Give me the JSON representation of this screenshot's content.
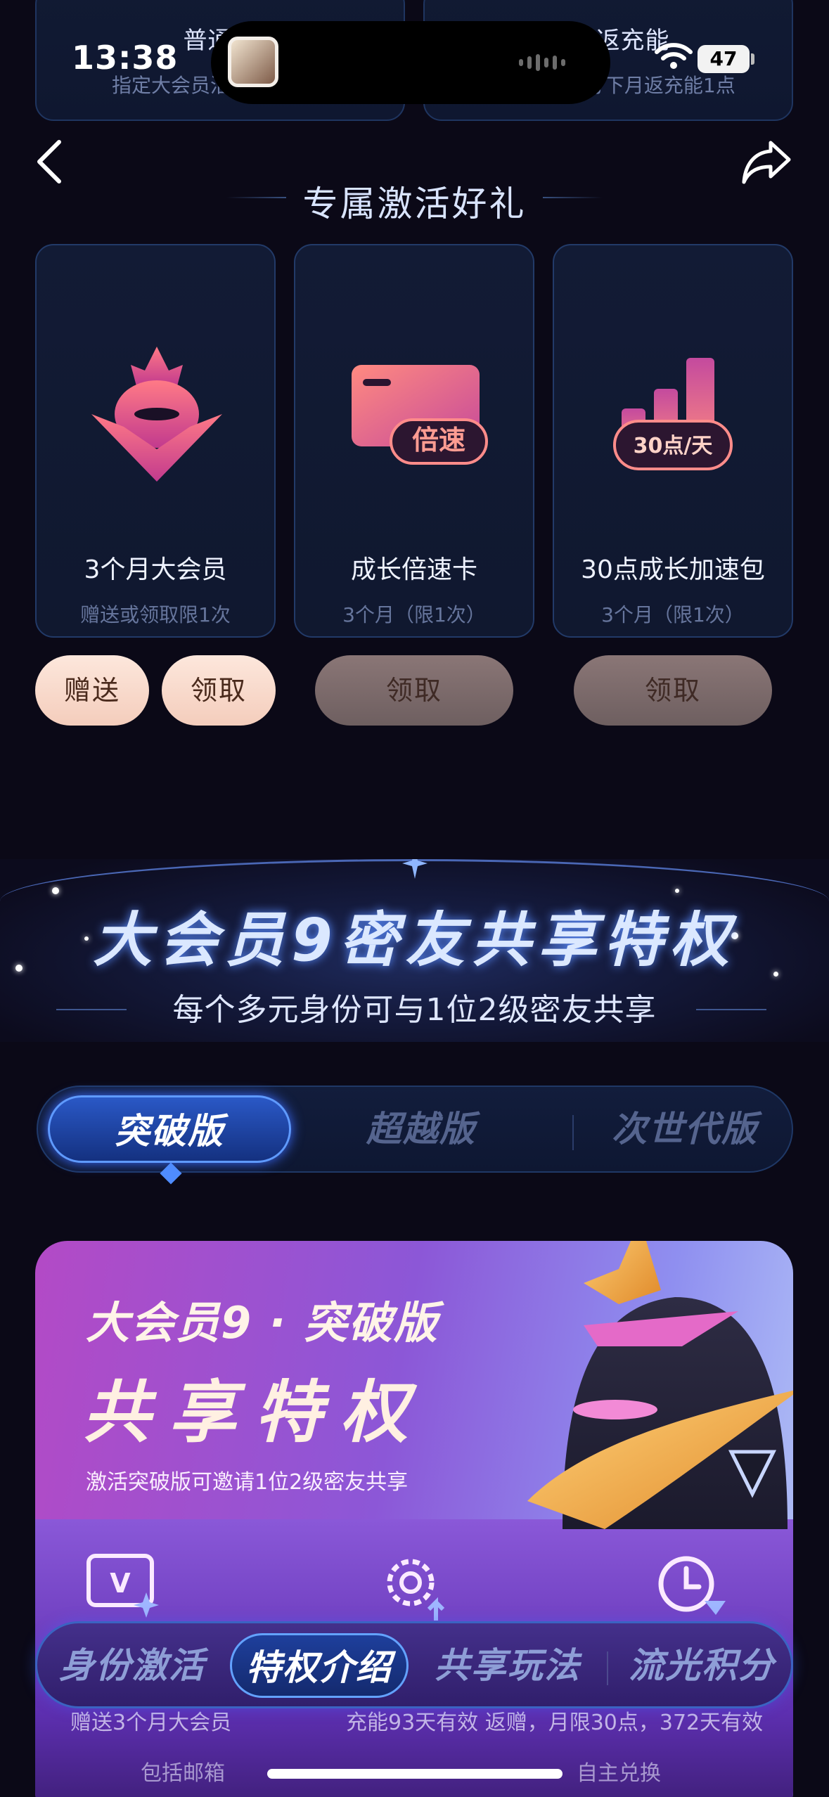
{
  "status_bar": {
    "time": "13:38",
    "battery": "47"
  },
  "top_cards": [
    {
      "title": "普通流",
      "subtitle": "指定大会员活动消费获得"
    },
    {
      "title": "积分返充能",
      "subtitle": "每累计30积分下月返充能1点"
    }
  ],
  "nav": {
    "back_icon": "chevron-left-icon",
    "share_icon": "share-icon"
  },
  "section_title": "专属激活好礼",
  "gifts": [
    {
      "title": "3个月大会员",
      "subtitle": "赠送或领取限1次",
      "icon": "mascot-icon"
    },
    {
      "title": "成长倍速卡",
      "subtitle": "3个月（限1次）",
      "icon": "speed-card-icon",
      "badge": "倍速"
    },
    {
      "title": "30点成长加速包",
      "subtitle": "3个月（限1次）",
      "icon": "growth-pack-icon",
      "badge": "30点/天"
    }
  ],
  "actions": {
    "gift1_give": "赠送",
    "gift1_claim": "领取",
    "gift2_claim": "领取",
    "gift3_claim": "领取"
  },
  "share_banner": {
    "title": "大会员9密友共享特权",
    "subtitle": "每个多元身份可与1位2级密友共享"
  },
  "version_tabs": [
    {
      "label": "突破版",
      "active": true
    },
    {
      "label": "超越版",
      "active": false
    },
    {
      "label": "次世代版",
      "active": false
    }
  ],
  "promo": {
    "line1": "大会员9 · 突破版",
    "line2": "共享特权",
    "line3": "激活突破版可邀请1位2级密友共享",
    "bottom_left": "赠送3个月大会员",
    "bottom_right": "充能93天有效   返赠，月限30点，372天有效",
    "bottom_left2": "包括邮箱",
    "bottom_right2": "自主兑换"
  },
  "bottom_nav": [
    {
      "label": "身份激活",
      "active": false
    },
    {
      "label": "特权介绍",
      "active": true
    },
    {
      "label": "共享玩法",
      "active": false
    },
    {
      "label": "流光积分",
      "active": false
    }
  ],
  "colors": {
    "background": "#0b0917",
    "accent_blue": "#3b6bff",
    "pill_light": "#f4cdbc",
    "pill_dim": "#7a6868"
  }
}
